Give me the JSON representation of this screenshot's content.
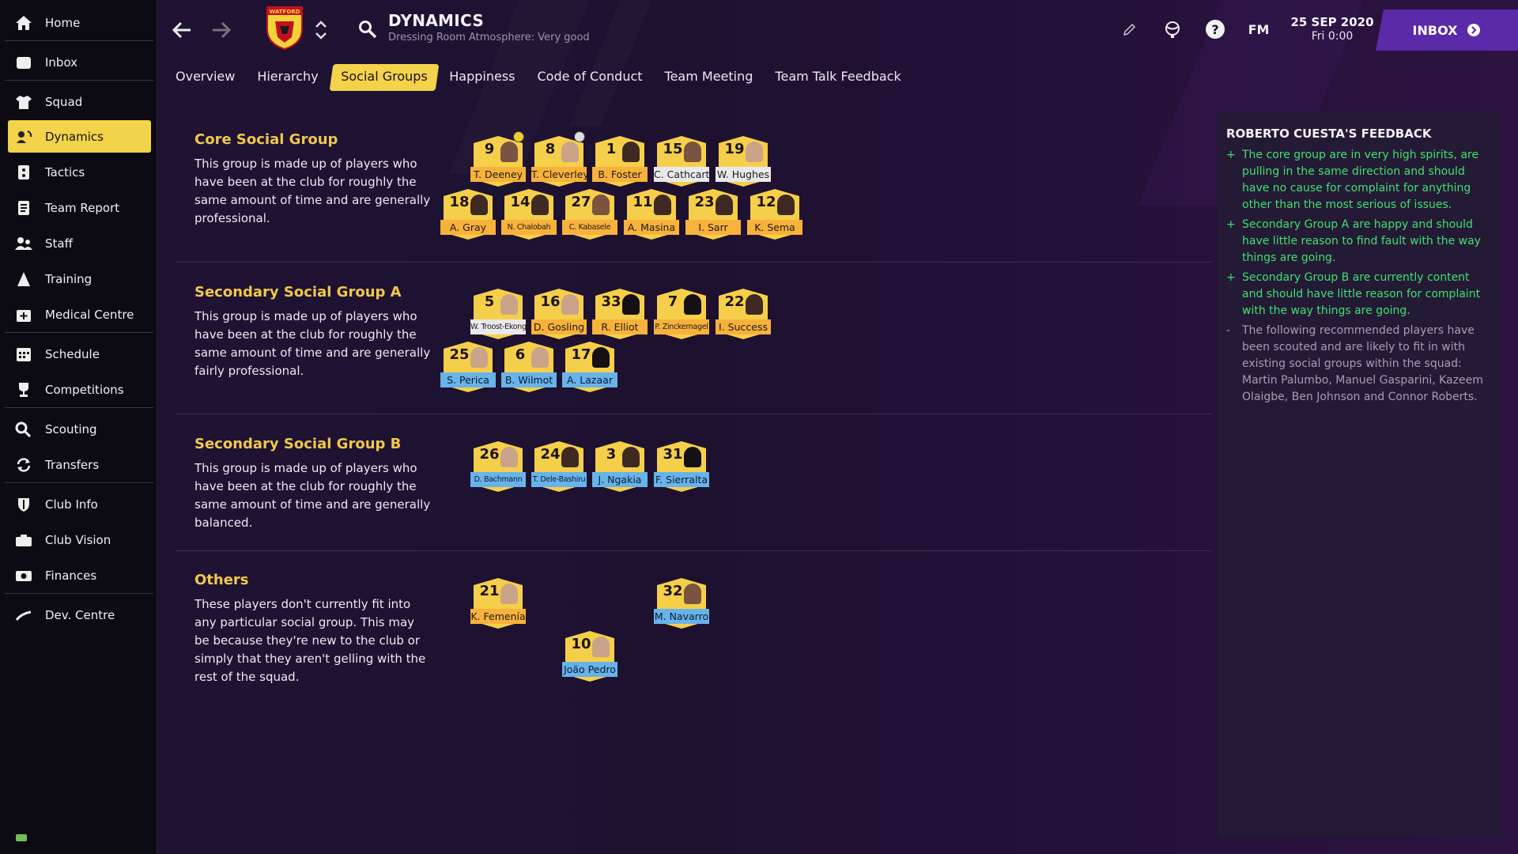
{
  "sidebar": {
    "items": [
      {
        "label": "Home",
        "icon": "home-icon"
      },
      {
        "label": "Inbox",
        "icon": "inbox-icon"
      },
      {
        "label": "Squad",
        "icon": "shirt-icon"
      },
      {
        "label": "Dynamics",
        "icon": "dynamics-icon",
        "active": true
      },
      {
        "label": "Tactics",
        "icon": "tactics-icon"
      },
      {
        "label": "Team Report",
        "icon": "report-icon"
      },
      {
        "label": "Staff",
        "icon": "staff-icon"
      },
      {
        "label": "Training",
        "icon": "training-icon"
      },
      {
        "label": "Medical Centre",
        "icon": "medical-icon"
      },
      {
        "label": "Schedule",
        "icon": "calendar-icon"
      },
      {
        "label": "Competitions",
        "icon": "trophy-icon"
      },
      {
        "label": "Scouting",
        "icon": "search-icon"
      },
      {
        "label": "Transfers",
        "icon": "transfer-icon"
      },
      {
        "label": "Club Info",
        "icon": "shield-icon"
      },
      {
        "label": "Club Vision",
        "icon": "vision-icon"
      },
      {
        "label": "Finances",
        "icon": "finances-icon"
      },
      {
        "label": "Dev. Centre",
        "icon": "dev-centre-icon"
      }
    ]
  },
  "header": {
    "title": "DYNAMICS",
    "subtitle": "Dressing Room Atmosphere: Very good",
    "club_badge_text": "WATFORD",
    "fm_label": "FM",
    "date": "25 SEP 2020",
    "time": "Fri 0:00",
    "inbox_label": "INBOX"
  },
  "tabs": [
    {
      "label": "Overview"
    },
    {
      "label": "Hierarchy"
    },
    {
      "label": "Social Groups",
      "active": true
    },
    {
      "label": "Happiness"
    },
    {
      "label": "Code of Conduct"
    },
    {
      "label": "Team Meeting"
    },
    {
      "label": "Team Talk Feedback"
    }
  ],
  "groups": [
    {
      "title": "Core Social Group",
      "description": "This group is made up of players who have been at the club for roughly the same amount of time and are generally professional.",
      "players": [
        {
          "number": "9",
          "name": "T. Deeney"
        },
        {
          "number": "8",
          "name": "T. Cleverley"
        },
        {
          "number": "1",
          "name": "B. Foster"
        },
        {
          "number": "15",
          "name": "C. Cathcart"
        },
        {
          "number": "19",
          "name": "W. Hughes"
        },
        {
          "number": "18",
          "name": "A. Gray"
        },
        {
          "number": "14",
          "name": "N. Chalobah"
        },
        {
          "number": "27",
          "name": "C. Kabasele"
        },
        {
          "number": "11",
          "name": "A. Masina"
        },
        {
          "number": "23",
          "name": "I. Sarr"
        },
        {
          "number": "12",
          "name": "K. Sema"
        }
      ]
    },
    {
      "title": "Secondary Social Group A",
      "description": "This group is made up of players who have been at the club for roughly the same amount of time and are generally fairly professional.",
      "players": [
        {
          "number": "5",
          "name": "W. Troost-Ekong"
        },
        {
          "number": "16",
          "name": "D. Gosling"
        },
        {
          "number": "33",
          "name": "R. Elliot"
        },
        {
          "number": "7",
          "name": "P. Zinckernagel"
        },
        {
          "number": "22",
          "name": "I. Success"
        },
        {
          "number": "25",
          "name": "S. Perica"
        },
        {
          "number": "6",
          "name": "B. Wilmot"
        },
        {
          "number": "17",
          "name": "A. Lazaar"
        }
      ]
    },
    {
      "title": "Secondary Social Group B",
      "description": "This group is made up of players who have been at the club for roughly the same amount of time and are generally balanced.",
      "players": [
        {
          "number": "26",
          "name": "D. Bachmann"
        },
        {
          "number": "24",
          "name": "T. Dele-Bashiru"
        },
        {
          "number": "3",
          "name": "J. Ngakia"
        },
        {
          "number": "31",
          "name": "F. Sierralta"
        }
      ]
    },
    {
      "title": "Others",
      "description": "These players don't currently fit into any particular social group. This may be because they're new to the club or simply that they aren't gelling with the rest of the squad.",
      "players": [
        {
          "number": "21",
          "name": "K. Femenía"
        },
        {
          "number": "32",
          "name": "M. Navarro"
        },
        {
          "number": "10",
          "name": "João Pedro"
        }
      ]
    }
  ],
  "feedback": {
    "title": "ROBERTO CUESTA'S FEEDBACK",
    "items": [
      {
        "marker": "+",
        "text": "The core group are in very high spirits, are pulling in the same direction and should have no cause for complaint for anything other than the most serious of issues."
      },
      {
        "marker": "+",
        "text": "Secondary Group A are happy and should have little reason to find fault with the way things are going."
      },
      {
        "marker": "+",
        "text": "Secondary Group B are currently content and should have little reason for complaint with the way things are going."
      },
      {
        "marker": "-",
        "text": "The following recommended players have been scouted and are likely to fit in with existing social groups within the squad: Martin Palumbo, Manuel Gasparini, Kazeem Olaigbe, Ben Johnson and Connor Roberts."
      }
    ]
  },
  "colors": {
    "accent_yellow": "#f2d34a",
    "inbox_purple": "#5a2aa8",
    "positive_green": "#3ee070",
    "group_title_gold": "#f0c84a"
  }
}
